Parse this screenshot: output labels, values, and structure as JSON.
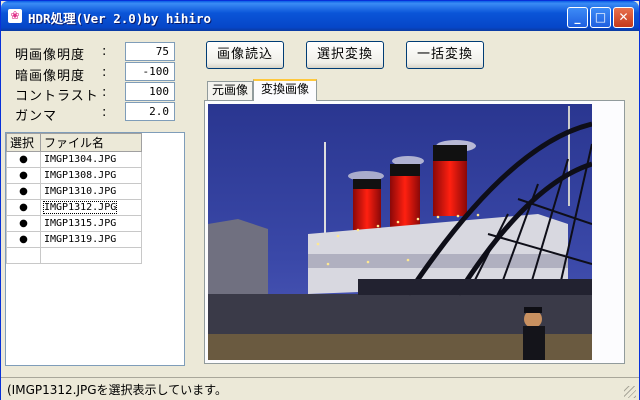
{
  "window": {
    "title": "HDR処理(Ver 2.0)by hihiro"
  },
  "params": [
    {
      "label": "明画像明度",
      "colon": ":",
      "value": "75"
    },
    {
      "label": "暗画像明度",
      "colon": ":",
      "value": "-100"
    },
    {
      "label": "コントラスト",
      "colon": ":",
      "value": "100"
    },
    {
      "label": "ガンマ",
      "colon": ":",
      "value": "2.0"
    }
  ],
  "file_list": {
    "headers": [
      "選択",
      "ファイル名"
    ],
    "rows": [
      {
        "mark": "●",
        "name": "IMGP1304.JPG"
      },
      {
        "mark": "●",
        "name": "IMGP1308.JPG"
      },
      {
        "mark": "●",
        "name": "IMGP1310.JPG"
      },
      {
        "mark": "●",
        "name": "IMGP1312.JPG"
      },
      {
        "mark": "●",
        "name": "IMGP1315.JPG"
      },
      {
        "mark": "●",
        "name": "IMGP1319.JPG"
      }
    ]
  },
  "toolbar": {
    "load": "画像読込",
    "convert_selected": "選択変換",
    "convert_all": "一括変換"
  },
  "tabs": [
    {
      "label": "元画像"
    },
    {
      "label": "変換画像"
    }
  ],
  "status": {
    "text": "(IMGP1312.JPGを選択表示しています。"
  },
  "colors": {
    "funnel_red": "#d01010",
    "funnel_black": "#111111",
    "sky": "#3440a0"
  }
}
